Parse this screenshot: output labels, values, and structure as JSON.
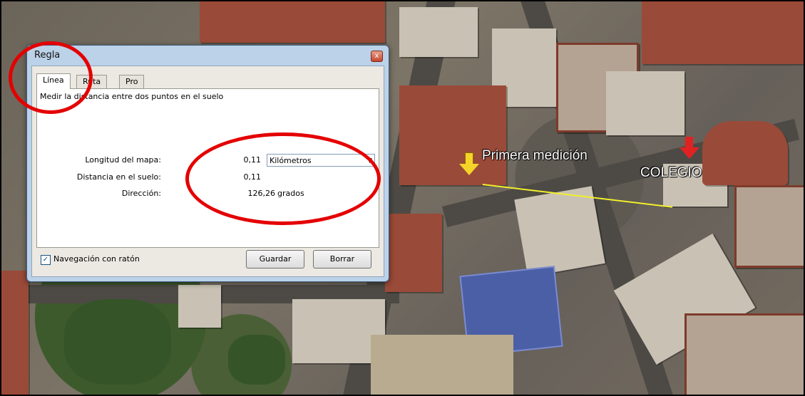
{
  "dialog": {
    "title": "Regla",
    "close_glyph": "x",
    "tabs": [
      {
        "label": "Línea",
        "active": true
      },
      {
        "label": "Ruta",
        "active": false
      },
      {
        "label": "Pro",
        "active": false
      }
    ],
    "description": "Medir la distancia entre dos puntos en el suelo",
    "map_length": {
      "label": "Longitud del mapa:",
      "value": "0,11"
    },
    "unit_select": {
      "selected": "Kilómetros"
    },
    "ground_distance": {
      "label": "Distancia en el suelo:",
      "value": "0,11"
    },
    "heading": {
      "label": "Dirección:",
      "value": "126,26",
      "unit": "grados"
    },
    "mouse_nav": {
      "label": "Navegación con ratón",
      "checked": true,
      "check_glyph": "✓"
    },
    "save_label": "Guardar",
    "clear_label": "Borrar"
  },
  "map": {
    "first_measurement_label": "Primera medición",
    "school_label": "COLEGIO",
    "measure_line_color": "#f2ef2c",
    "annotation_color": "#e40000"
  }
}
